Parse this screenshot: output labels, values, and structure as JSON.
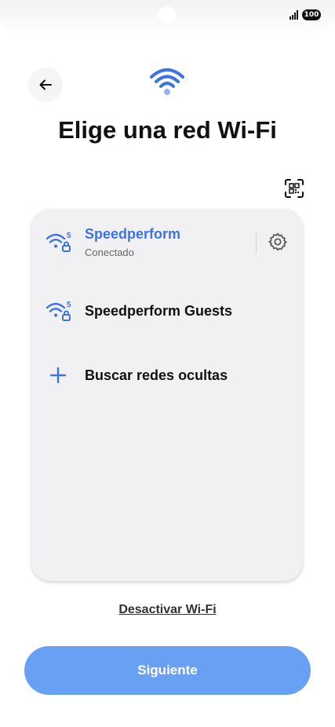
{
  "status_bar": {
    "battery": "100",
    "icons": [
      "signal-icon",
      "battery-icon"
    ]
  },
  "header": {
    "back_icon": "arrow-left-icon",
    "hero_icon": "wifi-icon",
    "title": "Elige una red Wi-Fi",
    "qr_icon": "qr-scan-icon"
  },
  "networks": [
    {
      "name": "Speedperform",
      "status": "Conectado",
      "band": "5",
      "icon": "wifi-5g-lock-icon",
      "settings_icon": "gear-icon",
      "connected": true
    },
    {
      "name": "Speedperform Guests",
      "band": "5",
      "icon": "wifi-5g-lock-icon",
      "connected": false
    }
  ],
  "hidden_networks": {
    "label": "Buscar redes ocultas",
    "icon": "plus-icon"
  },
  "footer": {
    "deactivate_label": "Desactivar Wi-Fi",
    "next_label": "Siguiente"
  },
  "colors": {
    "accent": "#3d74e0",
    "primary_button": "#68a1f3",
    "card_background": "#f1f1f4",
    "text": "#111111"
  }
}
